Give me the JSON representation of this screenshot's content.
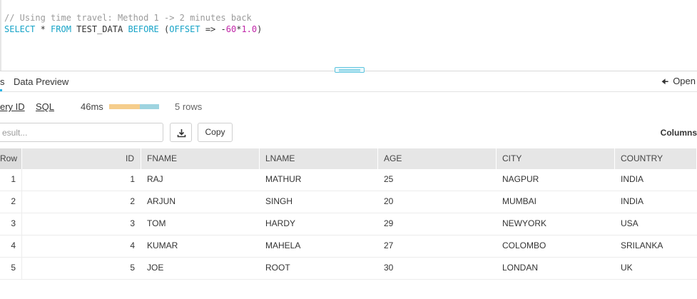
{
  "editor": {
    "comment": "// Using time travel: Method 1 -> 2 minutes back",
    "sql_select": "SELECT",
    "sql_star": " * ",
    "sql_from": "FROM",
    "sql_table": " TEST_DATA ",
    "sql_before": "BEFORE",
    "sql_paren_open": " (",
    "sql_offset": "OFFSET",
    "sql_arrow": " => ",
    "sql_minus": "-",
    "sql_n1": "60",
    "sql_mul": "*",
    "sql_n2": "1.0",
    "sql_paren_close": ")"
  },
  "tabs": {
    "results_label": "s",
    "preview_label": "Data Preview",
    "open_label": "Open"
  },
  "meta": {
    "query_id_label": "ery ID",
    "sql_label": "SQL",
    "duration": "46ms",
    "rows": "5 rows"
  },
  "toolbar": {
    "search_placeholder": "esult...",
    "copy_label": "Copy",
    "columns_label": "Columns"
  },
  "table": {
    "headers": [
      "Row",
      "ID",
      "FNAME",
      "LNAME",
      "AGE",
      "CITY",
      "COUNTRY"
    ],
    "rows": [
      [
        "1",
        "1",
        "RAJ",
        "MATHUR",
        "25",
        "NAGPUR",
        "INDIA"
      ],
      [
        "2",
        "2",
        "ARJUN",
        "SINGH",
        "20",
        "MUMBAI",
        "INDIA"
      ],
      [
        "3",
        "3",
        "TOM",
        "HARDY",
        "29",
        "NEWYORK",
        "USA"
      ],
      [
        "4",
        "4",
        "KUMAR",
        "MAHELA",
        "27",
        "COLOMBO",
        "SRILANKA"
      ],
      [
        "5",
        "5",
        "JOE",
        "ROOT",
        "30",
        "LONDAN",
        "UK"
      ]
    ]
  },
  "colors": {
    "accent": "#29b5e8",
    "keyword": "#16a3c7",
    "number": "#c026a8",
    "bar_compile": "#f5cd8c",
    "bar_execute": "#9ed4e0"
  }
}
